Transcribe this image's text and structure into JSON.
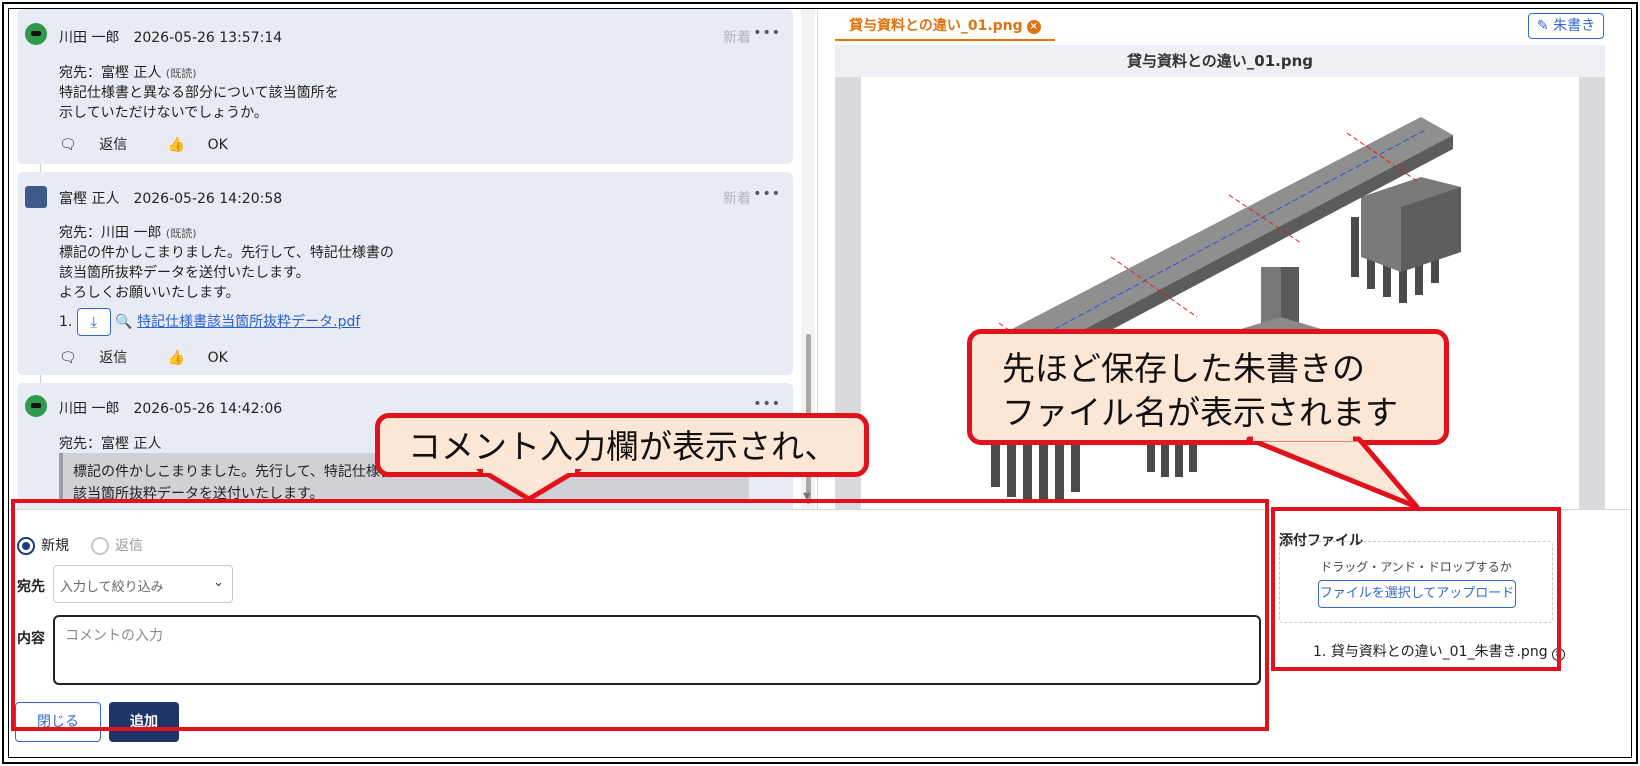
{
  "thread": {
    "messages": [
      {
        "sender": "川田 一郎",
        "timestamp": "2026-05-26 13:57:14",
        "new_badge": "新着",
        "to_label": "宛先：富樫 正人",
        "read_status": "(既読)",
        "body_lines": [
          "特記仕様書と異なる部分について該当箇所を",
          "示していただけないでしょうか。"
        ],
        "reply_label": "返信",
        "ok_label": "OK"
      },
      {
        "sender": "富樫 正人",
        "timestamp": "2026-05-26 14:20:58",
        "new_badge": "新着",
        "to_label": "宛先：川田 一郎",
        "read_status": "(既読)",
        "body_lines": [
          "標記の件かしこまりました。先行して、特記仕様書の",
          "該当箇所抜粋データを送付いたします。",
          "よろしくお願いいたします。"
        ],
        "attachment_index": "1.",
        "attachment_name": "特記仕様書該当箇所抜粋データ.pdf",
        "reply_label": "返信",
        "ok_label": "OK"
      },
      {
        "sender": "川田 一郎",
        "timestamp": "2026-05-26 14:42:06",
        "to_label": "宛先：富樫 正人",
        "quote_lines": [
          "標記の件かしこまりました。先行して、特記仕様書",
          "該当箇所抜粋データを送付いたします。"
        ]
      }
    ],
    "more_icon": "more-horizontal-icon"
  },
  "preview": {
    "tab_label": "貸与資料との違い_01.png",
    "title": "貸与資料との違い_01.png",
    "redline_label": "朱書き"
  },
  "form": {
    "radio_new": "新規",
    "radio_reply": "返信",
    "to_label": "宛先",
    "to_placeholder": "入力して絞り込み",
    "content_label": "内容",
    "content_placeholder": "コメントの入力",
    "close_label": "閉じる",
    "add_label": "追加"
  },
  "attachments": {
    "title": "添付ファイル",
    "drop_hint": "ドラッグ・アンド・ドロップするか",
    "upload_label": "ファイルを選択してアップロード",
    "files": [
      {
        "index": "1.",
        "name": "貸与資料との違い_01_朱書き.png"
      }
    ]
  },
  "annotations": {
    "callout_left": "コメント入力欄が表示され、",
    "callout_right_line1": "先ほど保存した朱書きの",
    "callout_right_line2": "ファイル名が表示されます"
  },
  "colors": {
    "annotation_red": "#e1121b",
    "callout_fill": "#fce7d6",
    "accent_orange": "#e0720f",
    "primary_navy": "#1f3469",
    "link_blue": "#3569c9"
  }
}
